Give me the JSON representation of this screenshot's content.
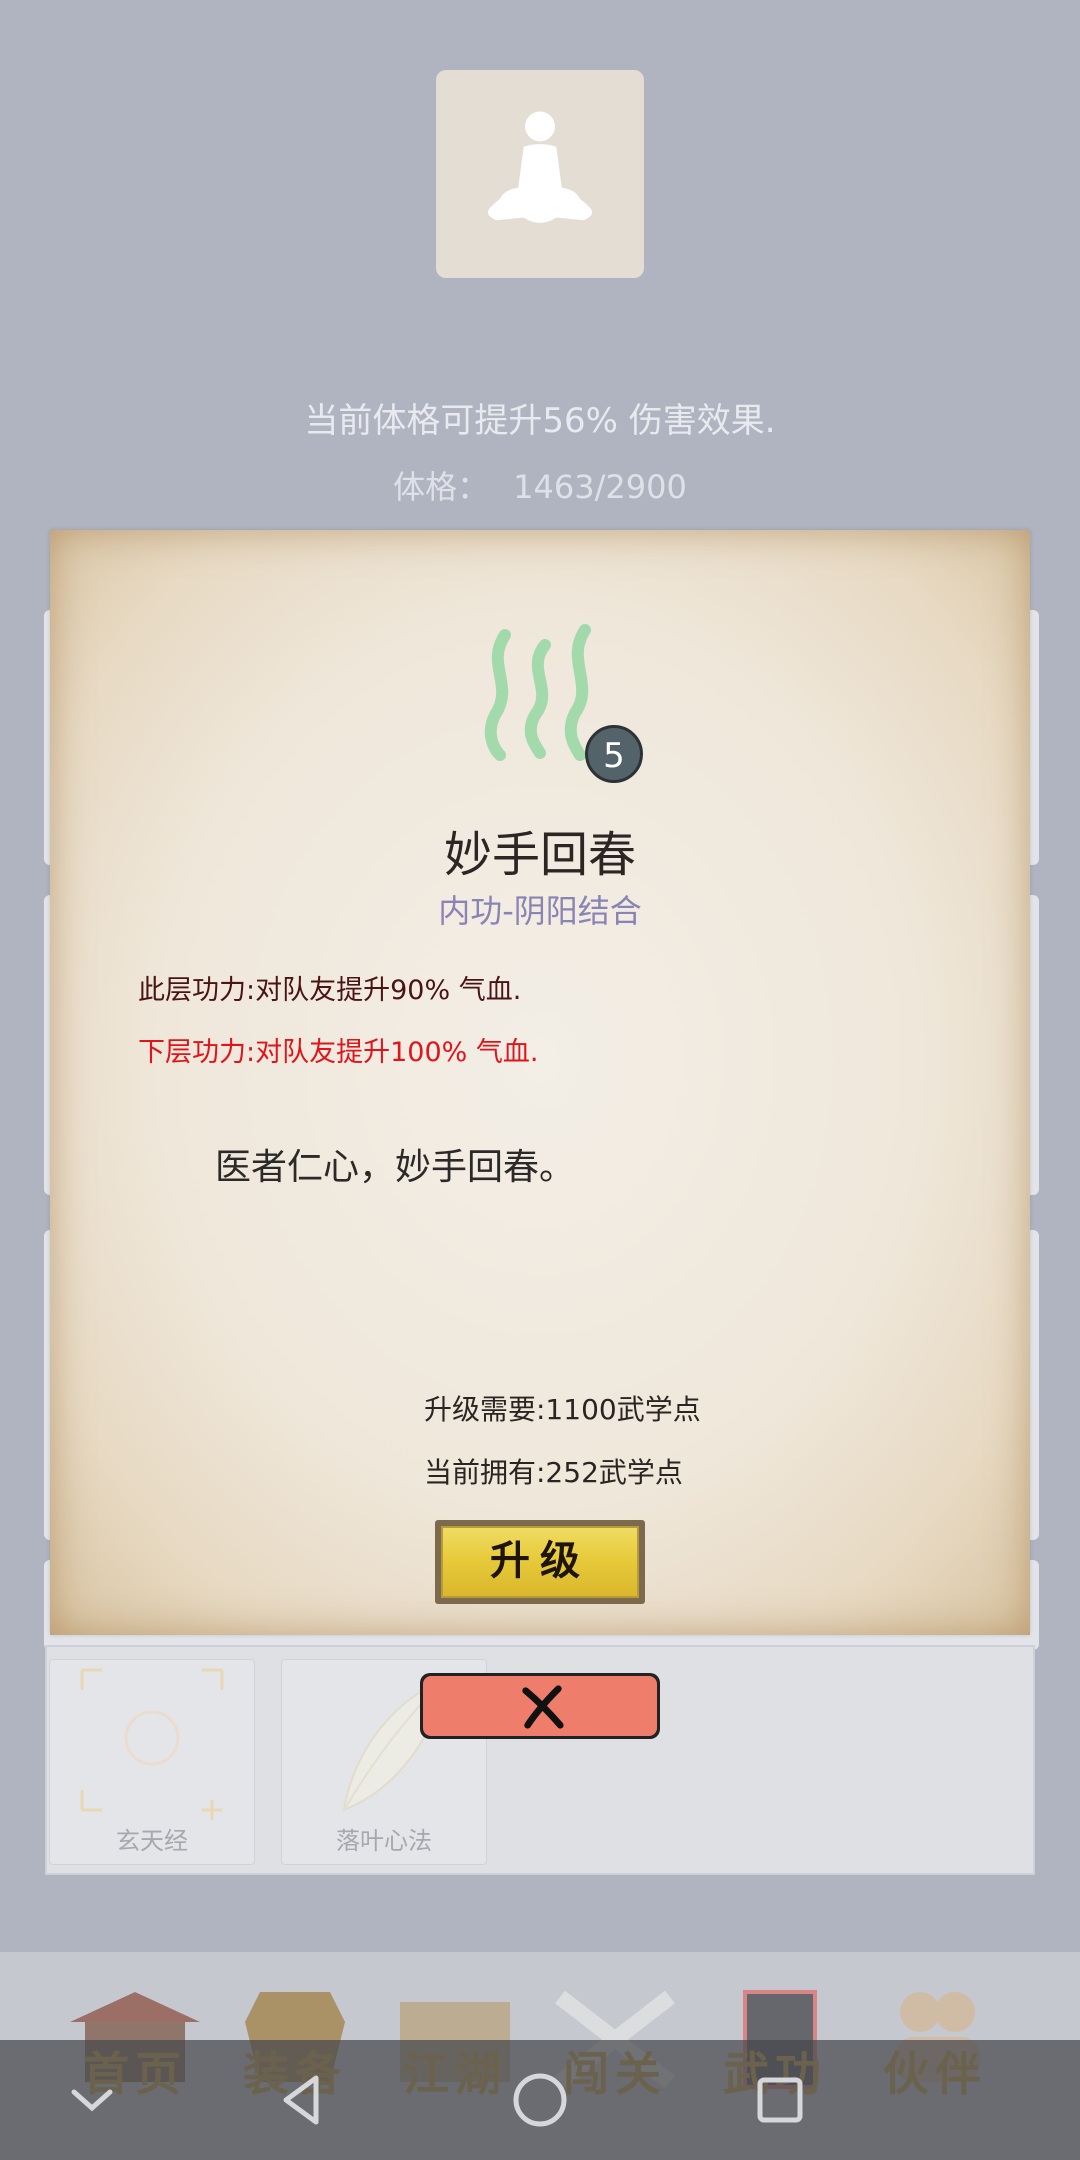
{
  "stats": {
    "description": "当前体格可提升56% 伤害效果.",
    "label": "体格：",
    "value": "1463/2900"
  },
  "skill": {
    "level": "5",
    "name": "妙手回春",
    "type": "内功-阴阳结合",
    "current_effect": "此层功力:对队友提升90% 气血.",
    "next_effect": "下层功力:对队友提升100% 气血.",
    "quote": "医者仁心，妙手回春。",
    "upgrade_need": "升级需要:1100武学点",
    "upgrade_have": "当前拥有:252武学点",
    "upgrade_label": "升级",
    "icon": "steam-icon"
  },
  "colors": {
    "next_effect": "#e0141b",
    "skill_type": "#8a84b5",
    "upgrade_button": "#e7cb3b",
    "close_button": "#ee7d6b"
  },
  "books": [
    {
      "label": "玄天经",
      "icon": "xuantian-icon"
    },
    {
      "label": "落叶心法",
      "icon": "leaf-icon"
    }
  ],
  "tabs": [
    {
      "label": "首页",
      "icon": "home-icon"
    },
    {
      "label": "装备",
      "icon": "armor-icon"
    },
    {
      "label": "江湖",
      "icon": "scroll-icon"
    },
    {
      "label": "闯关",
      "icon": "swords-icon"
    },
    {
      "label": "武功",
      "icon": "book-icon"
    },
    {
      "label": "伙伴",
      "icon": "partners-icon"
    }
  ]
}
